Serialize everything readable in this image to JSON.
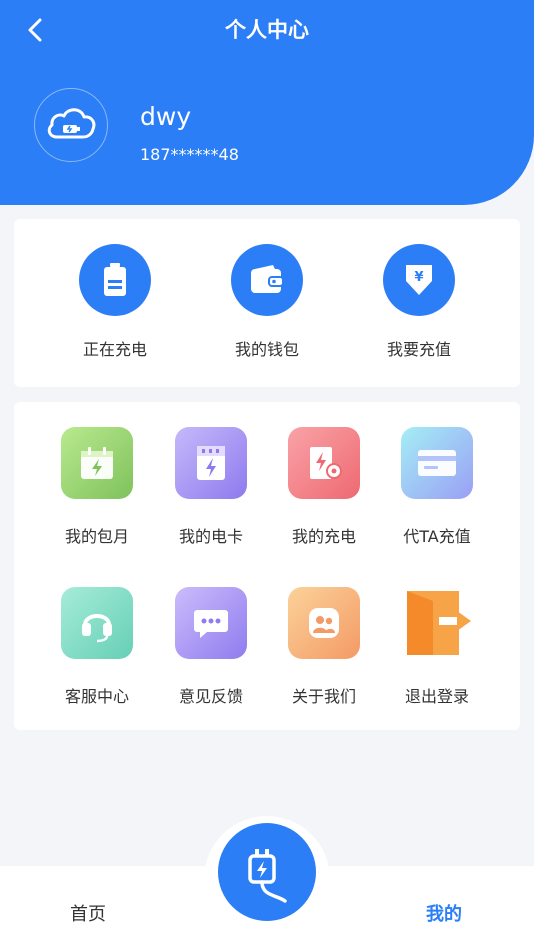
{
  "header": {
    "title": "个人中心"
  },
  "user": {
    "name": "dwy",
    "phone": "187******48"
  },
  "quick_actions": [
    {
      "label": "正在充电",
      "icon": "battery-icon"
    },
    {
      "label": "我的钱包",
      "icon": "wallet-icon"
    },
    {
      "label": "我要充值",
      "icon": "yen-recharge-icon"
    }
  ],
  "grid": [
    {
      "label": "我的包月",
      "icon": "calendar-bolt-icon",
      "color": "#8ccf6b"
    },
    {
      "label": "我的电卡",
      "icon": "electric-card-icon",
      "color": "#9c8cf0"
    },
    {
      "label": "我的充电",
      "icon": "charging-record-icon",
      "color": "#f47b82"
    },
    {
      "label": "代TA充值",
      "icon": "card-icon",
      "color": "#8fb7f8"
    },
    {
      "label": "客服中心",
      "icon": "headset-icon",
      "color": "#74d9c3"
    },
    {
      "label": "意见反馈",
      "icon": "chat-bubble-icon",
      "color": "#a58ff0"
    },
    {
      "label": "关于我们",
      "icon": "group-icon",
      "color": "#f8b27b"
    },
    {
      "label": "退出登录",
      "icon": "logout-door-icon",
      "color": "#f7a347"
    }
  ],
  "tabbar": {
    "home": "首页",
    "mine": "我的",
    "active_color": "#2b7ef5"
  }
}
